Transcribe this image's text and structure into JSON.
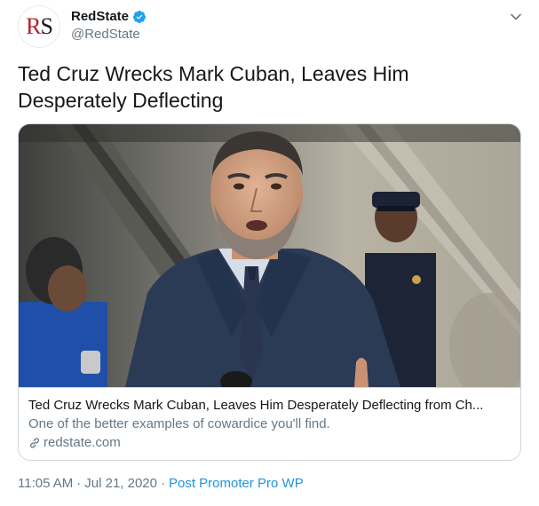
{
  "author": {
    "logo_letters": {
      "first": "R",
      "second": "S"
    },
    "display_name": "RedState",
    "handle": "@RedState",
    "verified": true
  },
  "tweet": {
    "text": "Ted Cruz Wrecks Mark Cuban, Leaves Him Desperately Deflecting"
  },
  "card": {
    "title": "Ted Cruz Wrecks Mark Cuban, Leaves Him Desperately Deflecting from Ch...",
    "description": "One of the better examples of cowardice you'll find.",
    "domain": "redstate.com"
  },
  "meta": {
    "time": "11:05 AM",
    "date": "Jul 21, 2020",
    "separator": "·",
    "source": "Post Promoter Pro WP"
  },
  "icons": {
    "verified": "verified-badge-icon",
    "chevron": "chevron-down-icon",
    "link": "link-icon"
  },
  "colors": {
    "brand_red": "#b8202b",
    "verified_blue": "#1da1f2",
    "link_blue": "#1b95e0",
    "secondary_text": "#657786"
  }
}
